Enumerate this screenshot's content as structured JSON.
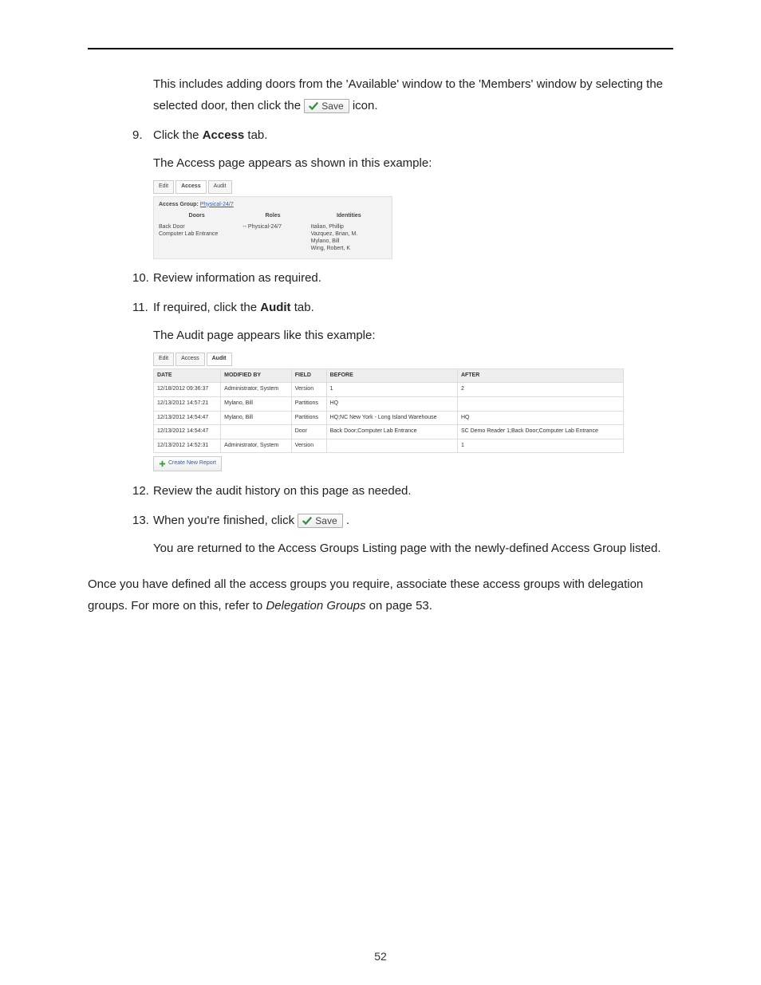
{
  "intro_para": "This includes adding doors from the 'Available' window to the 'Members' window by selecting the selected door, then click the ",
  "intro_tail": " icon.",
  "save_chip_label": "Save",
  "steps": {
    "s9_num": "9.",
    "s9_pre": "Click the ",
    "s9_bold": "Access",
    "s9_post": " tab.",
    "s9_sub": "The Access page appears as shown in this example:",
    "s10_num": "10.",
    "s10_text": "Review information as required.",
    "s11_num": "11.",
    "s11_pre": "If required, click the ",
    "s11_bold": "Audit",
    "s11_post": " tab.",
    "s11_sub": "The Audit page appears like this example:",
    "s12_num": "12.",
    "s12_text": "Review the audit history on this page as needed.",
    "s13_num": "13.",
    "s13_pre": "When you're finished, click ",
    "s13_post": " .",
    "s13_sub": "You are returned to the Access Groups Listing page with the newly-defined Access Group listed."
  },
  "closing_pre": "Once you have defined all the access groups you require, associate these access groups with delegation groups. For more on this, refer to ",
  "closing_ref": "Delegation Groups",
  "closing_post": " on page 53.",
  "page_number": "52",
  "access_mock": {
    "tabs": [
      "Edit",
      "Access",
      "Audit"
    ],
    "group_label": "Access Group:",
    "group_link": "Physical-24/7",
    "doors_hd": "Doors",
    "roles_hd": "Roles",
    "ident_hd": "Identities",
    "doors": [
      "Back Door",
      "Computer Lab Entrance"
    ],
    "roles": [
      "-- Physical-24/7"
    ],
    "identities": [
      "Italian, Phillip",
      "Vazquez, Brian, M.",
      "Mylano, Bill",
      "Wing, Robert, K"
    ]
  },
  "audit_mock": {
    "tabs": [
      "Edit",
      "Access",
      "Audit"
    ],
    "headers": [
      "Date",
      "Modified by",
      "Field",
      "Before",
      "After"
    ],
    "rows": [
      [
        "12/18/2012 09:36:37",
        "Administrator, System",
        "Version",
        "1",
        "2"
      ],
      [
        "12/13/2012 14:57:21",
        "Mylano, Bill",
        "Partitions",
        "HQ",
        ""
      ],
      [
        "12/13/2012 14:54:47",
        "Mylano, Bill",
        "Partitions",
        "HQ;NC New York - Long Island Warehouse",
        "HQ"
      ],
      [
        "12/13/2012 14:54:47",
        "",
        "Door",
        "Back Door;Computer Lab Entrance",
        "SC Demo Reader 1;Back Door;Computer Lab Entrance"
      ],
      [
        "12/13/2012 14:52:31",
        "Administrator, System",
        "Version",
        "",
        "1"
      ]
    ],
    "button": "Create New Report"
  }
}
